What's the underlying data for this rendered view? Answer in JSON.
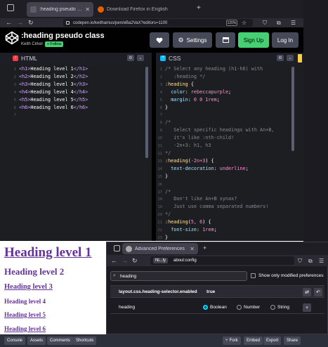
{
  "browser": {
    "tabs": [
      {
        "title": ":heading pseudo class"
      },
      {
        "title": "Download Firefox in English"
      }
    ],
    "url": "codepen.io/keithamus/pen/eBa2VaX?editors=1100",
    "zoom": "120%"
  },
  "header": {
    "title": ":heading pseudo class",
    "author": "Keith Cirkel",
    "follow_label": "+ Follow",
    "settings_label": "Settings",
    "signup_label": "Sign Up",
    "login_label": "Log In"
  },
  "html_pane": {
    "label": "HTML",
    "lines": [
      "<h1>Heading level 1</h1>",
      "<h2>Heading level 2</h2>",
      "<h3>Heading level 3</h3>",
      "<h4>Heading level 4</h4>",
      "<h5>Heading level 5</h5>",
      "<h6>Heading level 6</h6>",
      ""
    ]
  },
  "css_pane": {
    "label": "CSS",
    "lines": [
      "/* Select any heading (h1-h6) with",
      "   :heading */",
      ":heading {",
      "  color: rebeccapurple;",
      "  margin: 0 0 1rem;",
      "}",
      "",
      "/*",
      "   Select specific headings with An+B,",
      "   it's like :nth-child!",
      "   -2n+3: h1, h3",
      "*/",
      ":heading(-2n+3) {",
      "  text-decoration: underline;",
      "}",
      "",
      "/*",
      "   Don't like An+B synax?",
      "   Just use comma separated numbers!",
      "*/",
      ":heading(5, 6) {",
      "  font-size: 1rem;",
      "}"
    ]
  },
  "result": {
    "headings": [
      "Heading level 1",
      "Heading level 2",
      "Heading level 3",
      "Heading level 4",
      "Heading level 5",
      "Heading level 6"
    ]
  },
  "config_window": {
    "tab_title": "Advanced Preferences",
    "identity": "Ni...ly",
    "url": "about:config",
    "search_value": "heading",
    "show_modified_label": "Show only modified preferences",
    "existing_pref": {
      "name": "layout.css.heading-selector.enabled",
      "value": "true"
    },
    "new_pref": {
      "name": "heading",
      "options": [
        "Boolean",
        "Number",
        "String"
      ],
      "selected": "Boolean"
    }
  },
  "footer": {
    "left_buttons": [
      "Console",
      "Assets",
      "Comments",
      "Shortcuts"
    ],
    "right_buttons": [
      "Fork",
      "Embed",
      "Export",
      "Share"
    ]
  },
  "colors": {
    "heading_color": "#663399",
    "green": "#47cf73"
  }
}
